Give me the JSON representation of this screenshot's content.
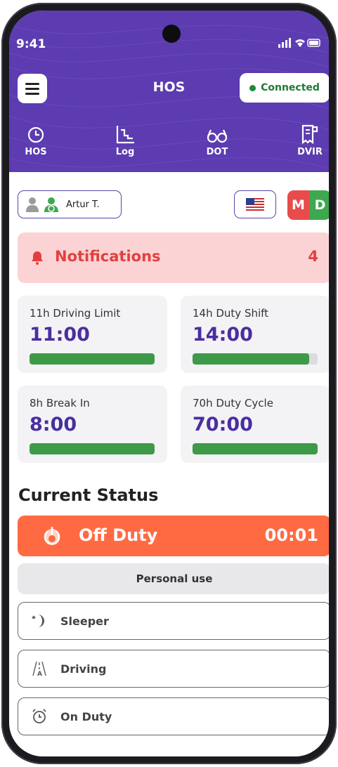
{
  "status_bar": {
    "time": "9:41"
  },
  "header": {
    "title": "HOS",
    "connection_label": "Connected"
  },
  "tabs": [
    {
      "label": "HOS",
      "icon": "clock-icon"
    },
    {
      "label": "Log",
      "icon": "chart-log-icon"
    },
    {
      "label": "DOT",
      "icon": "glasses-icon"
    },
    {
      "label": "DVIR",
      "icon": "document-icon"
    }
  ],
  "driver": {
    "name": "Artur T."
  },
  "country_flag": "us-flag-icon",
  "mode": {
    "m": "M",
    "d": "D"
  },
  "notifications": {
    "label": "Notifications",
    "count": "4"
  },
  "limits": [
    {
      "label": "11h Driving Limit",
      "value": "11:00",
      "progress": 1.0
    },
    {
      "label": "14h Duty Shift",
      "value": "14:00",
      "progress": 0.93
    },
    {
      "label": "8h Break In",
      "value": "8:00",
      "progress": 1.0
    },
    {
      "label": "70h Duty Cycle",
      "value": "70:00",
      "progress": 1.0
    }
  ],
  "current_status": {
    "title": "Current Status",
    "active_label": "Off Duty",
    "active_time": "00:01",
    "personal_use": "Personal use",
    "options": [
      "Sleeper",
      "Driving",
      "On Duty"
    ]
  },
  "colors": {
    "header": "#5c3cb0",
    "accent_value": "#4a2ea0",
    "progress": "#3e9a48",
    "off_duty": "#ff6a43",
    "notification_bg": "#fcd3d4",
    "notification_text": "#e24040"
  }
}
